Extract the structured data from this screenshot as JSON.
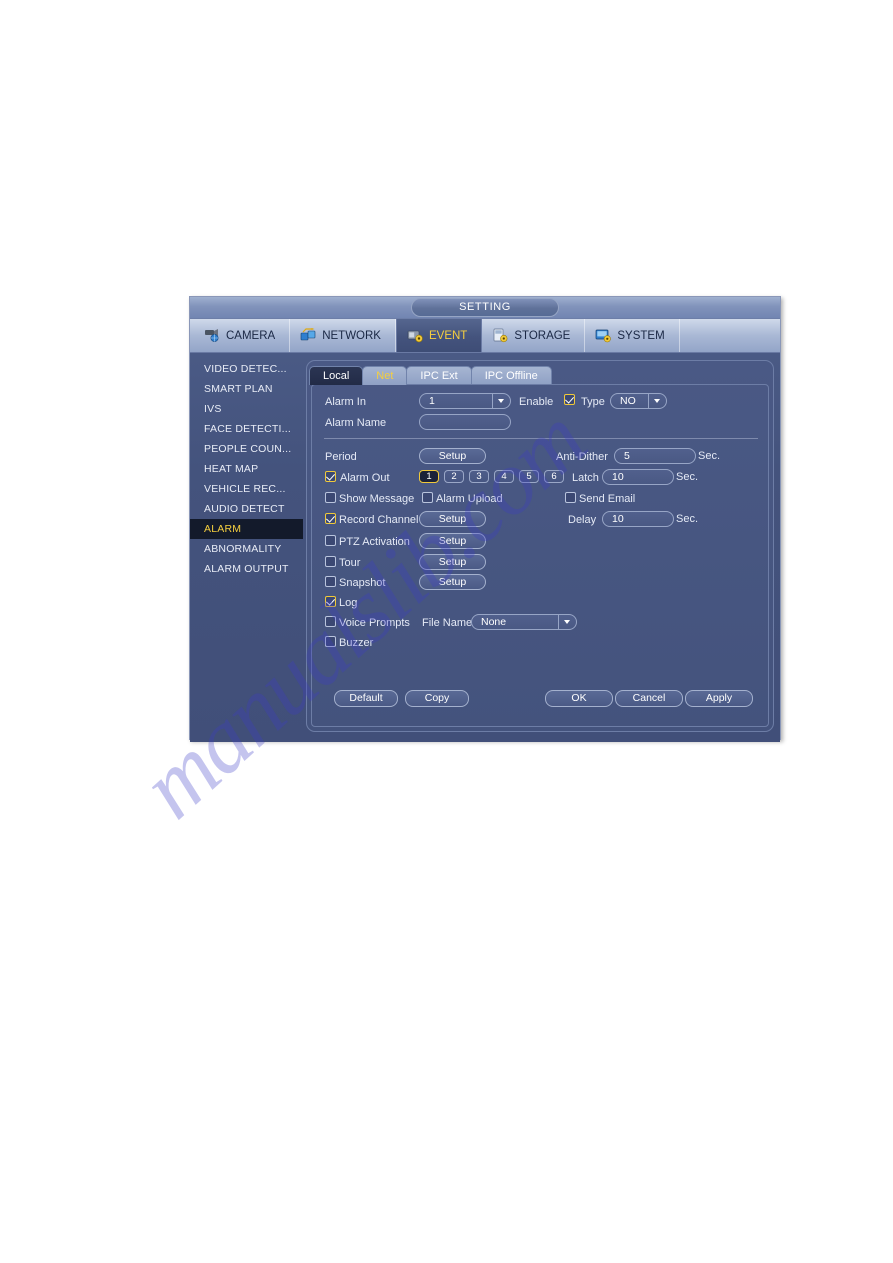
{
  "watermark": {
    "text": "manualslib.com"
  },
  "dialog": {
    "title": "SETTING"
  },
  "nav": {
    "items": [
      {
        "label": "CAMERA",
        "icon": "camera-icon",
        "active": false
      },
      {
        "label": "NETWORK",
        "icon": "network-icon",
        "active": false
      },
      {
        "label": "EVENT",
        "icon": "event-icon",
        "active": true
      },
      {
        "label": "STORAGE",
        "icon": "storage-icon",
        "active": false
      },
      {
        "label": "SYSTEM",
        "icon": "system-icon",
        "active": false
      }
    ]
  },
  "sidebar": {
    "items": [
      {
        "label": "VIDEO DETEC...",
        "selected": false
      },
      {
        "label": "SMART PLAN",
        "selected": false
      },
      {
        "label": "IVS",
        "selected": false
      },
      {
        "label": "FACE DETECTI...",
        "selected": false
      },
      {
        "label": "PEOPLE COUN...",
        "selected": false
      },
      {
        "label": "HEAT MAP",
        "selected": false
      },
      {
        "label": "VEHICLE REC...",
        "selected": false
      },
      {
        "label": "AUDIO DETECT",
        "selected": false
      },
      {
        "label": "ALARM",
        "selected": true
      },
      {
        "label": "ABNORMALITY",
        "selected": false
      },
      {
        "label": "ALARM OUTPUT",
        "selected": false
      }
    ]
  },
  "tabs": [
    {
      "label": "Local",
      "state": "active"
    },
    {
      "label": "Net",
      "state": "hover"
    },
    {
      "label": "IPC Ext",
      "state": "normal"
    },
    {
      "label": "IPC Offline",
      "state": "normal"
    }
  ],
  "form": {
    "alarm_in_label": "Alarm In",
    "alarm_in_value": "1",
    "enable_label": "Enable",
    "enable_checked": true,
    "type_label": "Type",
    "type_value": "NO",
    "alarm_name_label": "Alarm Name",
    "alarm_name_value": "",
    "period_label": "Period",
    "period_setup": "Setup",
    "anti_dither_label": "Anti-Dither",
    "anti_dither_value": "5",
    "anti_dither_unit": "Sec.",
    "alarm_out_label": "Alarm Out",
    "alarm_out_checked": true,
    "alarm_out_channels": [
      "1",
      "2",
      "3",
      "4",
      "5",
      "6"
    ],
    "alarm_out_selected": "1",
    "latch_label": "Latch",
    "latch_value": "10",
    "latch_unit": "Sec.",
    "show_message_label": "Show Message",
    "show_message_checked": false,
    "alarm_upload_label": "Alarm Upload",
    "alarm_upload_checked": false,
    "send_email_label": "Send Email",
    "send_email_checked": false,
    "record_channel_label": "Record Channel",
    "record_channel_checked": true,
    "record_channel_setup": "Setup",
    "delay_label": "Delay",
    "delay_value": "10",
    "delay_unit": "Sec.",
    "ptz_activation_label": "PTZ Activation",
    "ptz_activation_checked": false,
    "ptz_activation_setup": "Setup",
    "tour_label": "Tour",
    "tour_checked": false,
    "tour_setup": "Setup",
    "snapshot_label": "Snapshot",
    "snapshot_checked": false,
    "snapshot_setup": "Setup",
    "log_label": "Log",
    "log_checked": true,
    "voice_prompts_label": "Voice Prompts",
    "voice_prompts_checked": false,
    "file_name_label": "File Name",
    "file_name_value": "None",
    "buzzer_label": "Buzzer",
    "buzzer_checked": false
  },
  "footer": {
    "default_label": "Default",
    "copy_label": "Copy",
    "ok_label": "OK",
    "cancel_label": "Cancel",
    "apply_label": "Apply"
  },
  "colors": {
    "accent_yellow": "#f5cf3f",
    "dialog_bg": "#44537d",
    "selected_row": "#131a2b"
  }
}
